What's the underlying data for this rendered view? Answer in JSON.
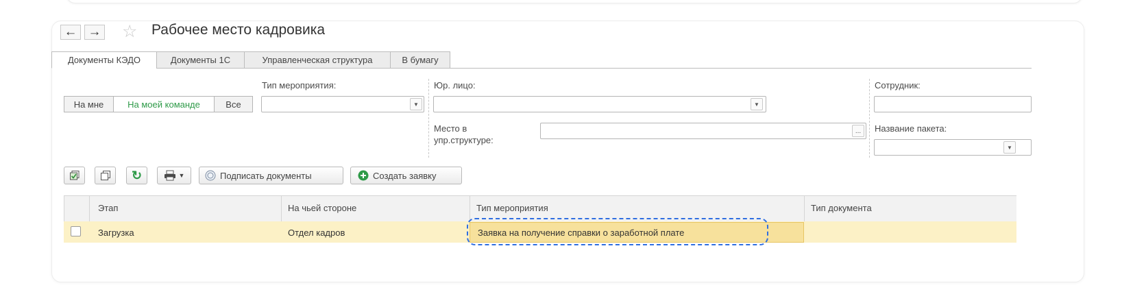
{
  "window": {
    "title": "Рабочее место кадровика"
  },
  "tabs": [
    {
      "label": "Документы КЭДО",
      "active": true
    },
    {
      "label": "Документы 1С",
      "active": false
    },
    {
      "label": "Управленческая структура",
      "active": false
    },
    {
      "label": "В бумагу",
      "active": false
    }
  ],
  "filters": {
    "scope": [
      "На мне",
      "На моей команде",
      "Все"
    ],
    "scope_selected": "На моей команде",
    "event_type_label": "Тип мероприятия:",
    "event_type_value": "",
    "legal_entity_label": "Юр. лицо:",
    "legal_entity_value": "",
    "place_label_line1": "Место в",
    "place_label_line2": "упр.структуре:",
    "place_value": "",
    "place_button": "...",
    "employee_label": "Сотрудник:",
    "employee_value": "",
    "package_label": "Название пакета:",
    "package_value": ""
  },
  "toolbar": {
    "sign_label": "Подписать документы",
    "create_label": "Создать заявку"
  },
  "table": {
    "columns": [
      "Этап",
      "На чьей стороне",
      "Тип мероприятия",
      "Тип документа"
    ],
    "rows": [
      {
        "checked": false,
        "stage": "Загрузка",
        "side": "Отдел кадров",
        "event_type": "Заявка на получение справки о заработной плате",
        "doc_type": ""
      }
    ]
  },
  "colors": {
    "accent_green": "#2e9a48",
    "row_selected": "#fcf1c6",
    "cell_selected": "#f7e19c",
    "highlight": "#2f6ee0"
  }
}
